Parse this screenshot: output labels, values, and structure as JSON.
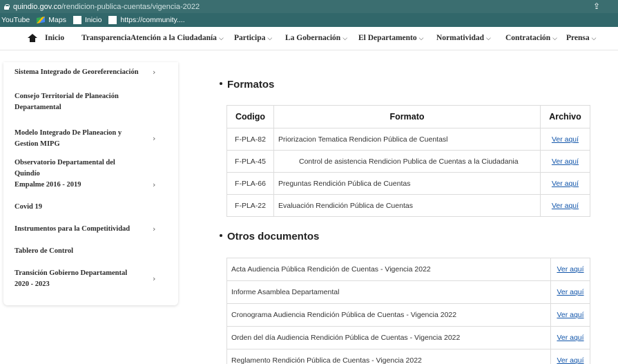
{
  "browser": {
    "url_host": "quindio.gov.co",
    "url_path": "/rendicion-publica-cuentas/vigencia-2022",
    "bookmarks": [
      "YouTube",
      "Maps",
      "Inicio",
      "https://community...."
    ]
  },
  "nav": {
    "items": [
      "Inicio",
      "Transparencia",
      "Atención a la Ciudadanía",
      "Participa",
      "La Gobernación",
      "El Departamento",
      "Normatividad",
      "Contratación",
      "Prensa"
    ],
    "chevron": "⌵"
  },
  "sidebar": {
    "items": [
      {
        "label": "Sistema Integrado de Georeferenciación",
        "arrow": "›"
      },
      {
        "label": "Consejo Territorial de Planeación Departamental",
        "arrow": ""
      },
      {
        "label": "Modelo Integrado De Planeacion y Gestion MIPG",
        "arrow": "›"
      },
      {
        "label": "Observatorio Departamental del Quindío",
        "arrow": ""
      },
      {
        "label": "Empalme 2016 - 2019",
        "arrow": "›"
      },
      {
        "label": "Covid 19",
        "arrow": ""
      },
      {
        "label": "Instrumentos para la Competitividad",
        "arrow": "›"
      },
      {
        "label": "Tablero de Control",
        "arrow": ""
      },
      {
        "label": "Transición Gobierno Departamental 2020 - 2023",
        "arrow": "›"
      }
    ]
  },
  "formatos": {
    "title": "Formatos",
    "headers": [
      "Codigo",
      "Formato",
      "Archivo"
    ],
    "rows": [
      {
        "code": "F-PLA-82",
        "name": "Priorizacion Tematica Rendicion Pública de Cuentasl",
        "link": "Ver aquí"
      },
      {
        "code": "F-PLA-45",
        "name": "Control de asistencia Rendicion Publica de Cuentas a la Ciudadania",
        "link": "Ver aquí"
      },
      {
        "code": "F-PLA-66",
        "name": "Preguntas Rendición Pública de Cuentas",
        "link": "Ver aquí"
      },
      {
        "code": "F-PLA-22",
        "name": "Evaluación Rendición Pública de Cuentas",
        "link": "Ver aquí"
      }
    ]
  },
  "otros": {
    "title": "Otros documentos",
    "rows": [
      {
        "name": "Acta Audiencia Pública Rendición de Cuentas - Vigencia 2022",
        "link": "Ver aquí"
      },
      {
        "name": "Informe Asamblea Departamental",
        "link": "Ver aquí"
      },
      {
        "name": "Cronograma Audiencia Rendición Pública de Cuentas - Vigencia 2022",
        "link": "Ver aquí"
      },
      {
        "name": "Orden del día Audiencia Rendición Pública de Cuentas -  Vigencia 2022",
        "link": "Ver aquí"
      },
      {
        "name": "Reglamento Rendición Pública de Cuentas - Vigencia 2022",
        "link": "Ver aquí"
      }
    ]
  },
  "colors": {
    "urlbar": "#3b6e70",
    "bookmarks": "#31676a",
    "link": "#1155aa"
  }
}
